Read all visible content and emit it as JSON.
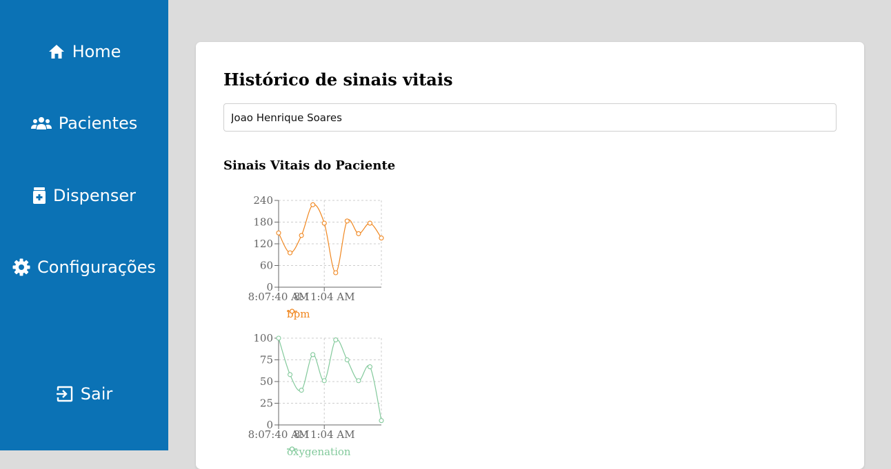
{
  "sidebar": {
    "items": [
      {
        "label": "Home",
        "icon": "home-icon"
      },
      {
        "label": "Pacientes",
        "icon": "users-icon"
      },
      {
        "label": "Dispenser",
        "icon": "medicine-jar-icon"
      },
      {
        "label": "Configurações",
        "icon": "gear-icon"
      },
      {
        "label": "Sair",
        "icon": "logout-icon"
      }
    ],
    "background": "#0b72b5"
  },
  "main": {
    "title": "Histórico de sinais vitais",
    "patient_input": {
      "value": "Joao Henrique Soares"
    },
    "section_title": "Sinais Vitais do Paciente"
  },
  "chart_data": [
    {
      "type": "line",
      "x": [
        "8:07:40 AM",
        "",
        "",
        "",
        "8:11:04 AM",
        "",
        "",
        "",
        "",
        ""
      ],
      "xticks": [
        "8:07:40 AM",
        "8:11:04 AM"
      ],
      "yticks": [
        0,
        60,
        120,
        180,
        240
      ],
      "ylim": [
        0,
        240
      ],
      "grid": true,
      "series": [
        {
          "name": "bpm",
          "color": "#f0861e",
          "values": [
            150,
            95,
            143,
            228,
            177,
            40,
            183,
            148,
            177,
            136
          ]
        }
      ],
      "legend": "bottom"
    },
    {
      "type": "line",
      "x": [
        "8:07:40 AM",
        "",
        "",
        "",
        "8:11:04 AM",
        "",
        "",
        "",
        "",
        ""
      ],
      "xticks": [
        "8:07:40 AM",
        "8:11:04 AM"
      ],
      "yticks": [
        0,
        25,
        50,
        75,
        100
      ],
      "ylim": [
        0,
        100
      ],
      "grid": true,
      "series": [
        {
          "name": "oxygenation",
          "color": "#82c99b",
          "values": [
            100,
            58,
            40,
            81,
            51,
            98,
            75,
            51,
            67,
            5
          ]
        }
      ],
      "legend": "bottom"
    }
  ]
}
